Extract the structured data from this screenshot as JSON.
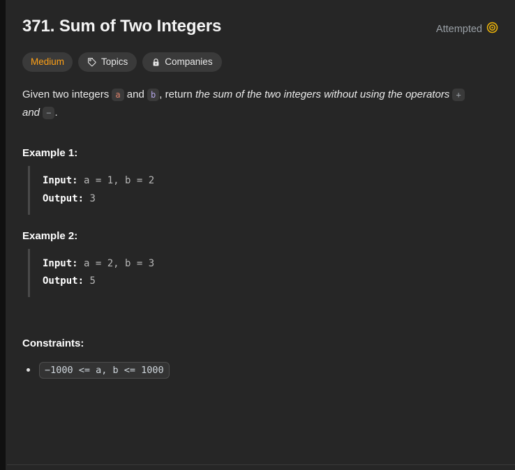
{
  "problem": {
    "title": "371. Sum of Two Integers",
    "status_label": "Attempted",
    "status_icon": "target-icon",
    "tags": [
      {
        "label": "Medium",
        "icon": null,
        "kind": "difficulty"
      },
      {
        "label": "Topics",
        "icon": "tag-icon",
        "kind": "normal"
      },
      {
        "label": "Companies",
        "icon": "lock-icon",
        "kind": "normal"
      }
    ],
    "description": {
      "part1": "Given two integers ",
      "code_a": "a",
      "part2": " and ",
      "code_b": "b",
      "part3": ", return ",
      "emphasis1": "the sum of the two integers without using the operators ",
      "code_plus": "+",
      "emphasis2": " and ",
      "code_minus": "−",
      "part4": "."
    },
    "examples": [
      {
        "heading": "Example 1:",
        "input_label": "Input:",
        "input_value": " a = 1, b = 2",
        "output_label": "Output:",
        "output_value": " 3"
      },
      {
        "heading": "Example 2:",
        "input_label": "Input:",
        "input_value": " a = 2, b = 3",
        "output_label": "Output:",
        "output_value": " 5"
      }
    ],
    "constraints": {
      "heading": "Constraints:",
      "items": [
        "−1000 <= a, b <= 1000"
      ]
    }
  },
  "colors": {
    "panel_bg": "#262626",
    "gutter": "#101010",
    "difficulty_medium": "#ffa116",
    "status_icon": "#e9b10a",
    "status_text": "#9aa0a6",
    "pill_bg": "#3a3a3a",
    "code_var_a": "#e0836c",
    "code_var_b": "#b3a5e6",
    "example_bar": "#4a4a4a"
  }
}
